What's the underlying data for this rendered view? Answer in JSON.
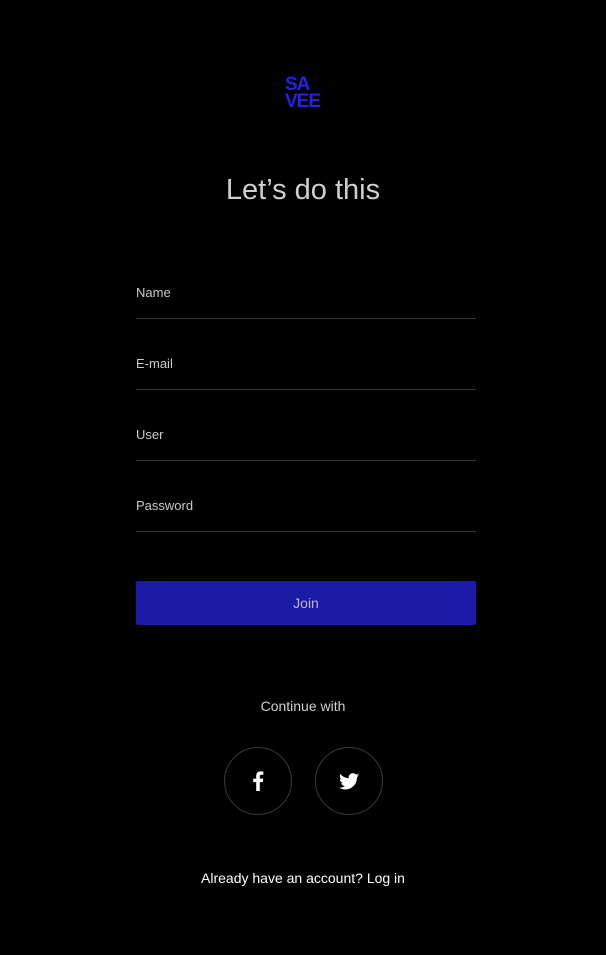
{
  "brand": {
    "logo_line1": "SA",
    "logo_line2": "VEE",
    "accent_color": "#2323e6"
  },
  "page": {
    "title": "Let’s do this"
  },
  "form": {
    "name_placeholder": "Name",
    "email_placeholder": "E-mail",
    "user_placeholder": "User",
    "password_placeholder": "Password",
    "join_label": "Join",
    "join_color": "#1a1aa6"
  },
  "social": {
    "continue_label": "Continue with",
    "buttons": [
      {
        "icon": "facebook-icon"
      },
      {
        "icon": "twitter-icon"
      }
    ]
  },
  "footer": {
    "prompt": "Already have an account?",
    "login_label": "Log in"
  }
}
